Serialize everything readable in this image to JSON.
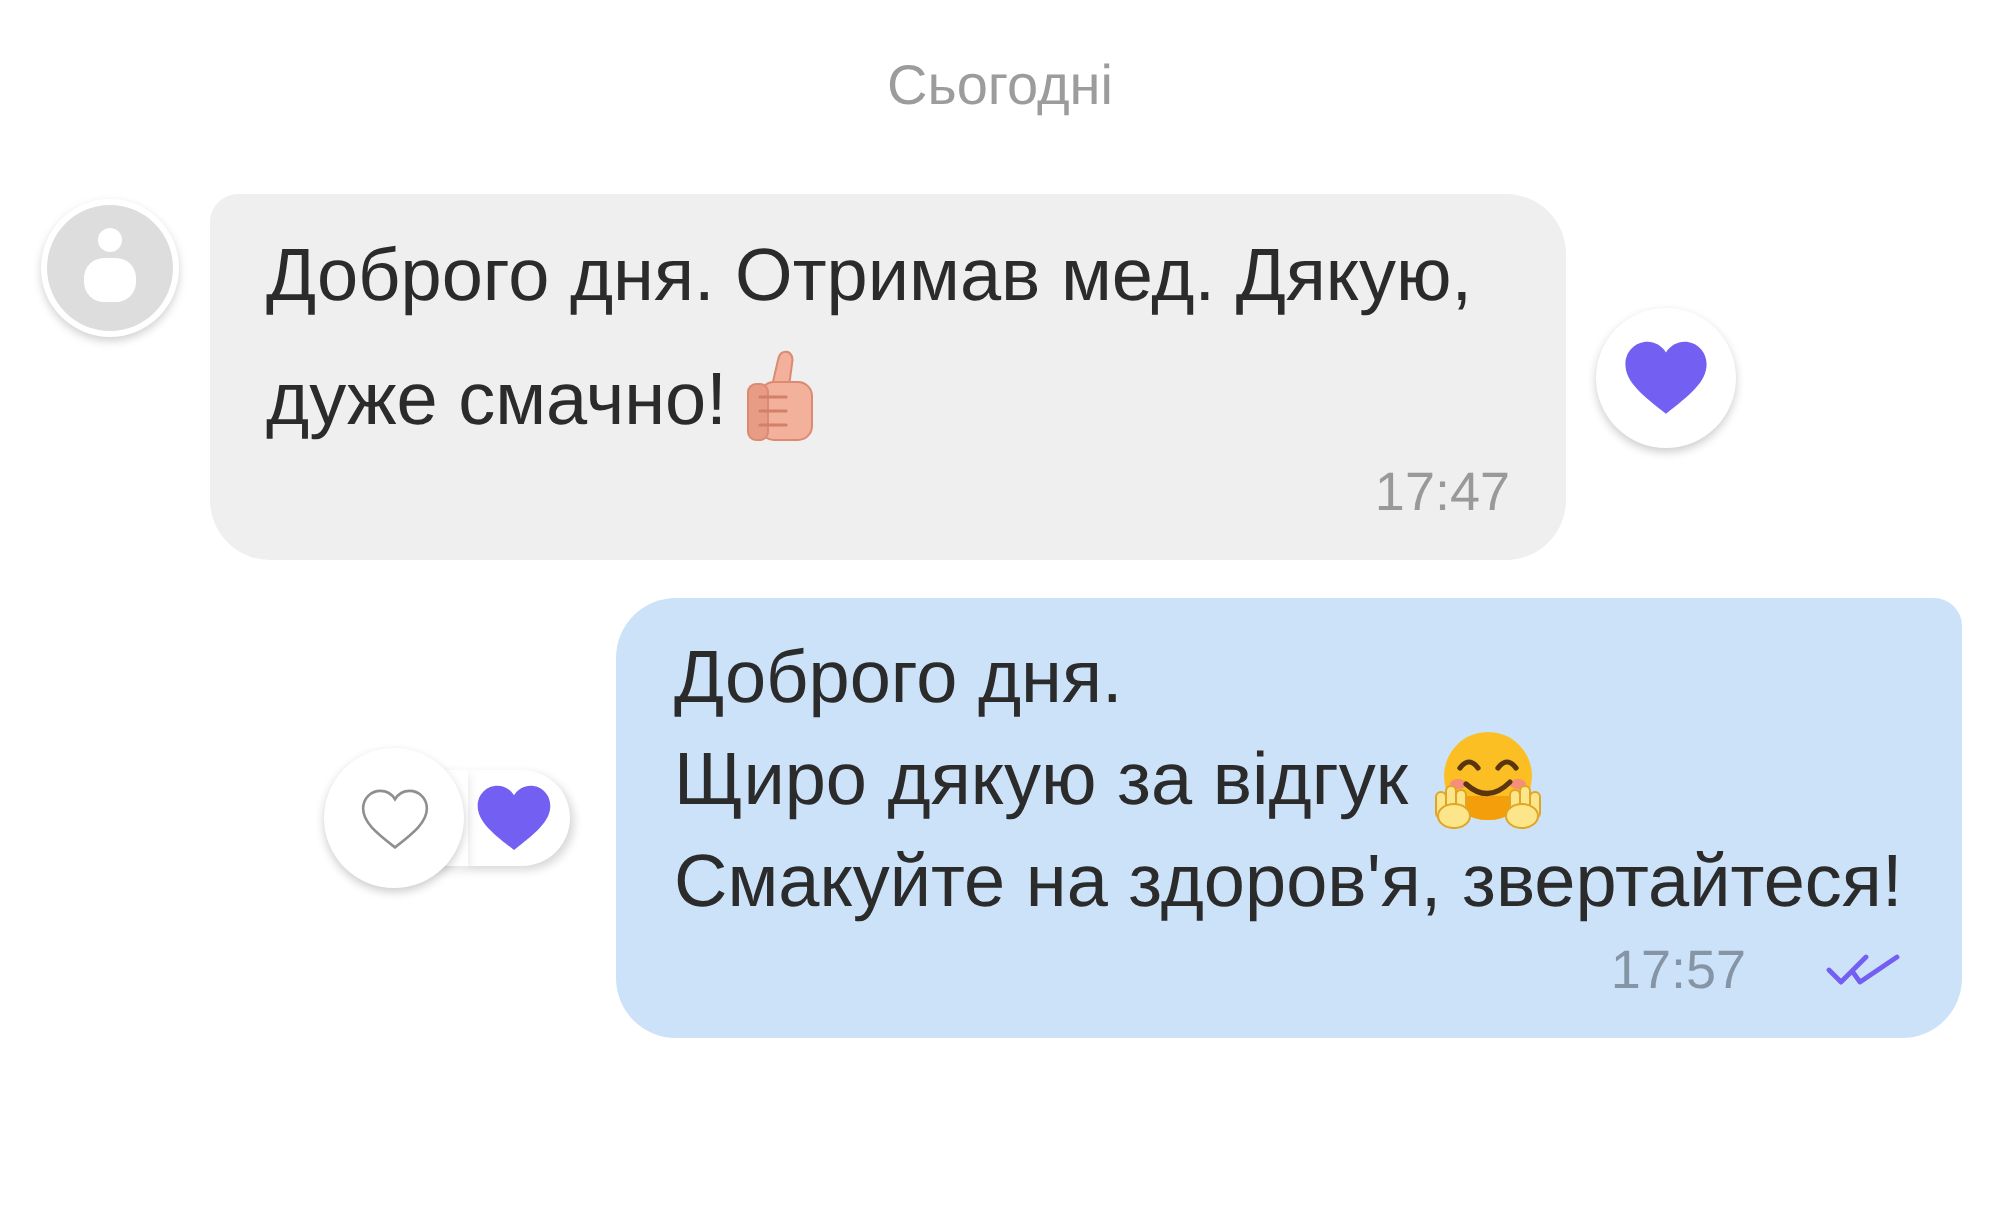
{
  "date_divider": "Сьогодні",
  "messages": [
    {
      "kind": "incoming",
      "lines": [
        {
          "kind": "plain",
          "text": "Доброго дня. Отримав мед. Дякую,"
        },
        {
          "kind": "thumbs_up",
          "text": "дуже смачно!"
        }
      ],
      "time": "17:47",
      "reactions": [
        {
          "kind": "circle",
          "liked": true
        }
      ]
    },
    {
      "kind": "outgoing",
      "lines": [
        {
          "kind": "plain",
          "text": "Доброго дня."
        },
        {
          "kind": "hugging",
          "text": "Щиро дякую за відгук"
        },
        {
          "kind": "plain",
          "text": "Смакуйте на здоров'я, звертайтеся!"
        }
      ],
      "time": "17:57",
      "read": true,
      "reactions": [
        {
          "kind": "circle",
          "liked": false
        },
        {
          "kind": "pill",
          "liked": true
        }
      ]
    }
  ]
}
